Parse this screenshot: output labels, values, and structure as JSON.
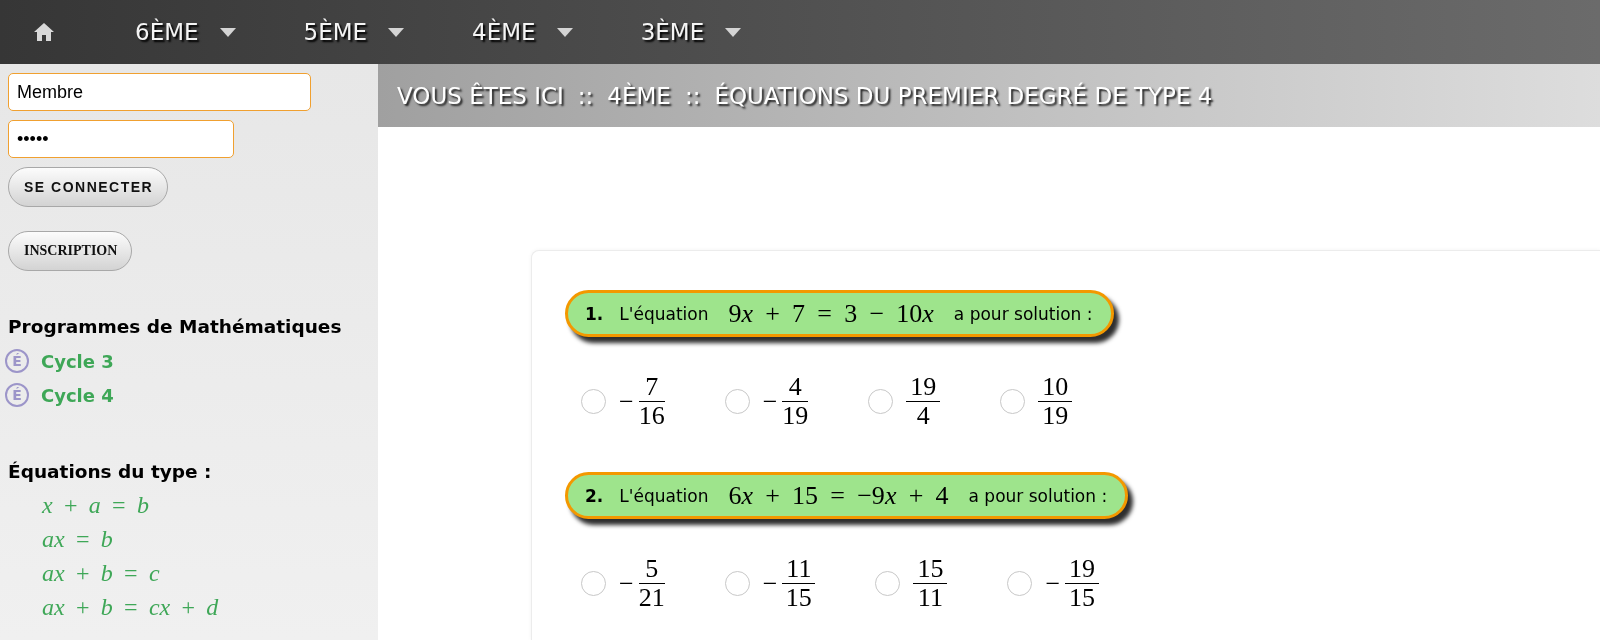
{
  "nav": {
    "items": [
      {
        "label": "6ÈME"
      },
      {
        "label": "5ÈME"
      },
      {
        "label": "4ÈME"
      },
      {
        "label": "3ÈME"
      }
    ]
  },
  "login": {
    "username": {
      "value": "Membre"
    },
    "password": {
      "value": "•••••"
    },
    "buttons": [
      {
        "label": "SE CONNECTER",
        "kind": "login"
      },
      {
        "label": "INSCRIPTION",
        "kind": "register"
      }
    ]
  },
  "programs": {
    "title": "Programmes de Mathématiques",
    "links": [
      {
        "badge": "É",
        "label": "Cycle 3"
      },
      {
        "badge": "É",
        "label": "Cycle 4"
      }
    ]
  },
  "equation_types": {
    "title": "Équations du type :",
    "items": [
      "x + a = b",
      "ax = b",
      "ax + b = c",
      "ax + b = cx + d"
    ]
  },
  "breadcrumb": {
    "prefix": "VOUS ÊTES ICI",
    "crumbs": [
      {
        "separator": "::",
        "label": "4ÈME"
      },
      {
        "separator": "::",
        "label": "ÉQUATIONS DU PREMIER DEGRÉ DE TYPE 4"
      }
    ]
  },
  "questions": [
    {
      "number": "1.",
      "intro": "L'équation",
      "equation": "9x + 7 = 3 − 10x",
      "outro": "a pour solution :",
      "options": [
        {
          "sign": "−",
          "numerator": "7",
          "denominator": "16",
          "selected": false
        },
        {
          "sign": "−",
          "numerator": "4",
          "denominator": "19",
          "selected": false
        },
        {
          "numerator": "19",
          "denominator": "4",
          "selected": false
        },
        {
          "numerator": "10",
          "denominator": "19",
          "selected": false
        }
      ]
    },
    {
      "number": "2.",
      "intro": "L'équation",
      "equation": "6x + 15 = −9x + 4",
      "outro": "a pour solution :",
      "options": [
        {
          "sign": "−",
          "numerator": "5",
          "denominator": "21",
          "selected": false
        },
        {
          "sign": "−",
          "numerator": "11",
          "denominator": "15",
          "selected": false
        },
        {
          "numerator": "15",
          "denominator": "11",
          "selected": false
        },
        {
          "sign": "−",
          "numerator": "19",
          "denominator": "15",
          "selected": false
        }
      ]
    }
  ]
}
